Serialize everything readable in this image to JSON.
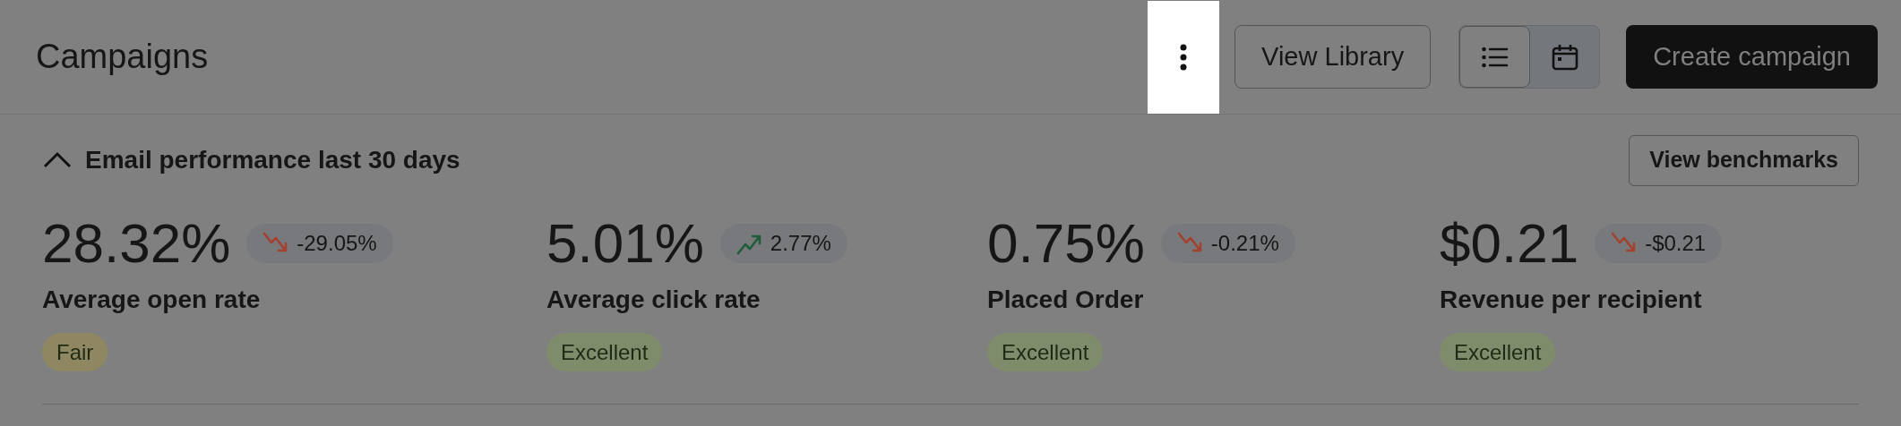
{
  "header": {
    "title": "Campaigns",
    "view_toggle": [
      {
        "kind": "list",
        "selected": true
      },
      {
        "kind": "calendar",
        "selected": false
      }
    ],
    "buttons": [
      {
        "kind": "outline",
        "label": "View Library"
      },
      {
        "kind": "primary",
        "label": "Create campaign"
      }
    ]
  },
  "performance": {
    "title": "Email performance last 30 days",
    "expanded": true,
    "button": "View benchmarks",
    "metrics": [
      {
        "value": "28.32%",
        "change": "-29.05%",
        "kind": "down",
        "label": "Average open rate",
        "rating": "Fair",
        "color": "#8f8762"
      },
      {
        "value": "5.01%",
        "change": "2.77%",
        "kind": "up",
        "label": "Average click rate",
        "rating": "Excellent",
        "color": "#7f8c6c"
      },
      {
        "value": "0.75%",
        "change": "-0.21%",
        "kind": "down",
        "label": "Placed Order",
        "rating": "Excellent",
        "color": "#7f8c6c"
      },
      {
        "value": "$0.21",
        "change": "-$0.21",
        "kind": "down",
        "label": "Revenue per recipient",
        "rating": "Excellent",
        "color": "#7f8c6c"
      }
    ]
  }
}
